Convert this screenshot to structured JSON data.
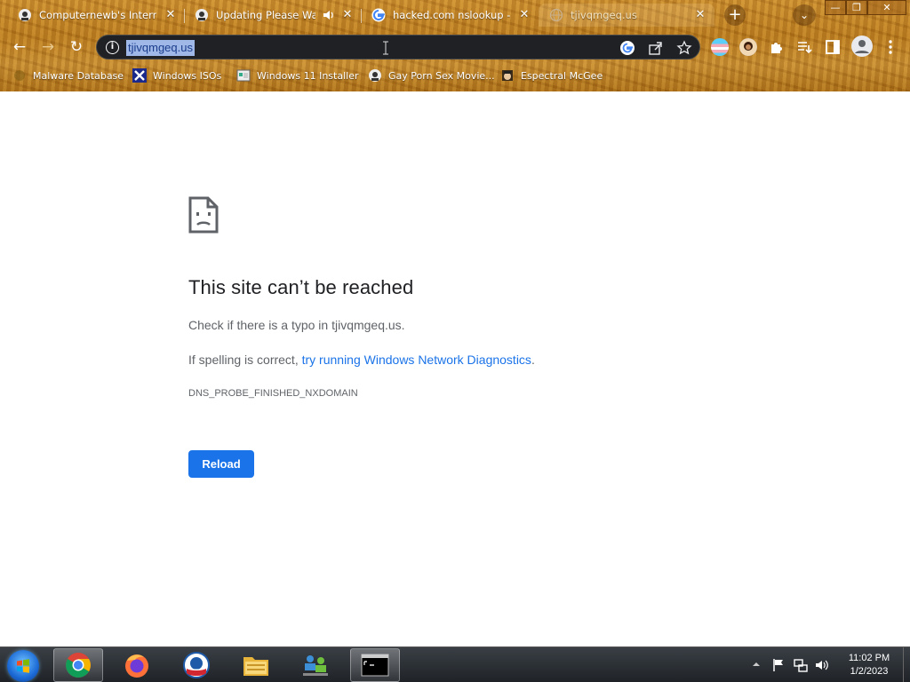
{
  "browser": {
    "tabs": [
      {
        "title": "Computernewb's Internet",
        "favicon": "app-favicon",
        "close": "✕"
      },
      {
        "title": "Updating Please Wait",
        "favicon": "app-favicon",
        "audio": "speaker-icon",
        "close": "✕"
      },
      {
        "title": "hacked.com nslookup - Go",
        "favicon": "google-favicon",
        "close": "✕"
      },
      {
        "title": "tjivqmgeq.us",
        "favicon": "globe-favicon",
        "close": "✕"
      }
    ],
    "new_tab": "+",
    "tab_search": "⌄",
    "window_controls": {
      "minimize": "—",
      "maximize": "❐",
      "close": "✕"
    },
    "toolbar": {
      "back": "←",
      "forward": "→",
      "reload": "↻",
      "url": "tjivqmgeq.us"
    },
    "bookmarks": [
      {
        "label": "Malware Database",
        "icon": "malware-icon"
      },
      {
        "label": "Windows ISOs",
        "icon": "x-icon"
      },
      {
        "label": "Windows 11 Installer",
        "icon": "installer-icon"
      },
      {
        "label": "Gay Porn Sex Movie...",
        "icon": "app-favicon"
      },
      {
        "label": "Espectral McGee",
        "icon": "character-icon"
      }
    ]
  },
  "error_page": {
    "title": "This site can’t be reached",
    "line1_prefix": "Check if there is a typo in ",
    "line1_host": "tjivqmgeq.us",
    "line1_suffix": ".",
    "line2_prefix": "If spelling is correct, ",
    "line2_link": "try running Windows Network Diagnostics",
    "line2_suffix": ".",
    "error_code": "DNS_PROBE_FINISHED_NXDOMAIN",
    "reload_label": "Reload"
  },
  "taskbar": {
    "apps": [
      "chrome",
      "firefox",
      "obama",
      "file-explorer",
      "network",
      "command-prompt"
    ],
    "clock_time": "11:02 PM",
    "clock_date": "1/2/2023"
  }
}
